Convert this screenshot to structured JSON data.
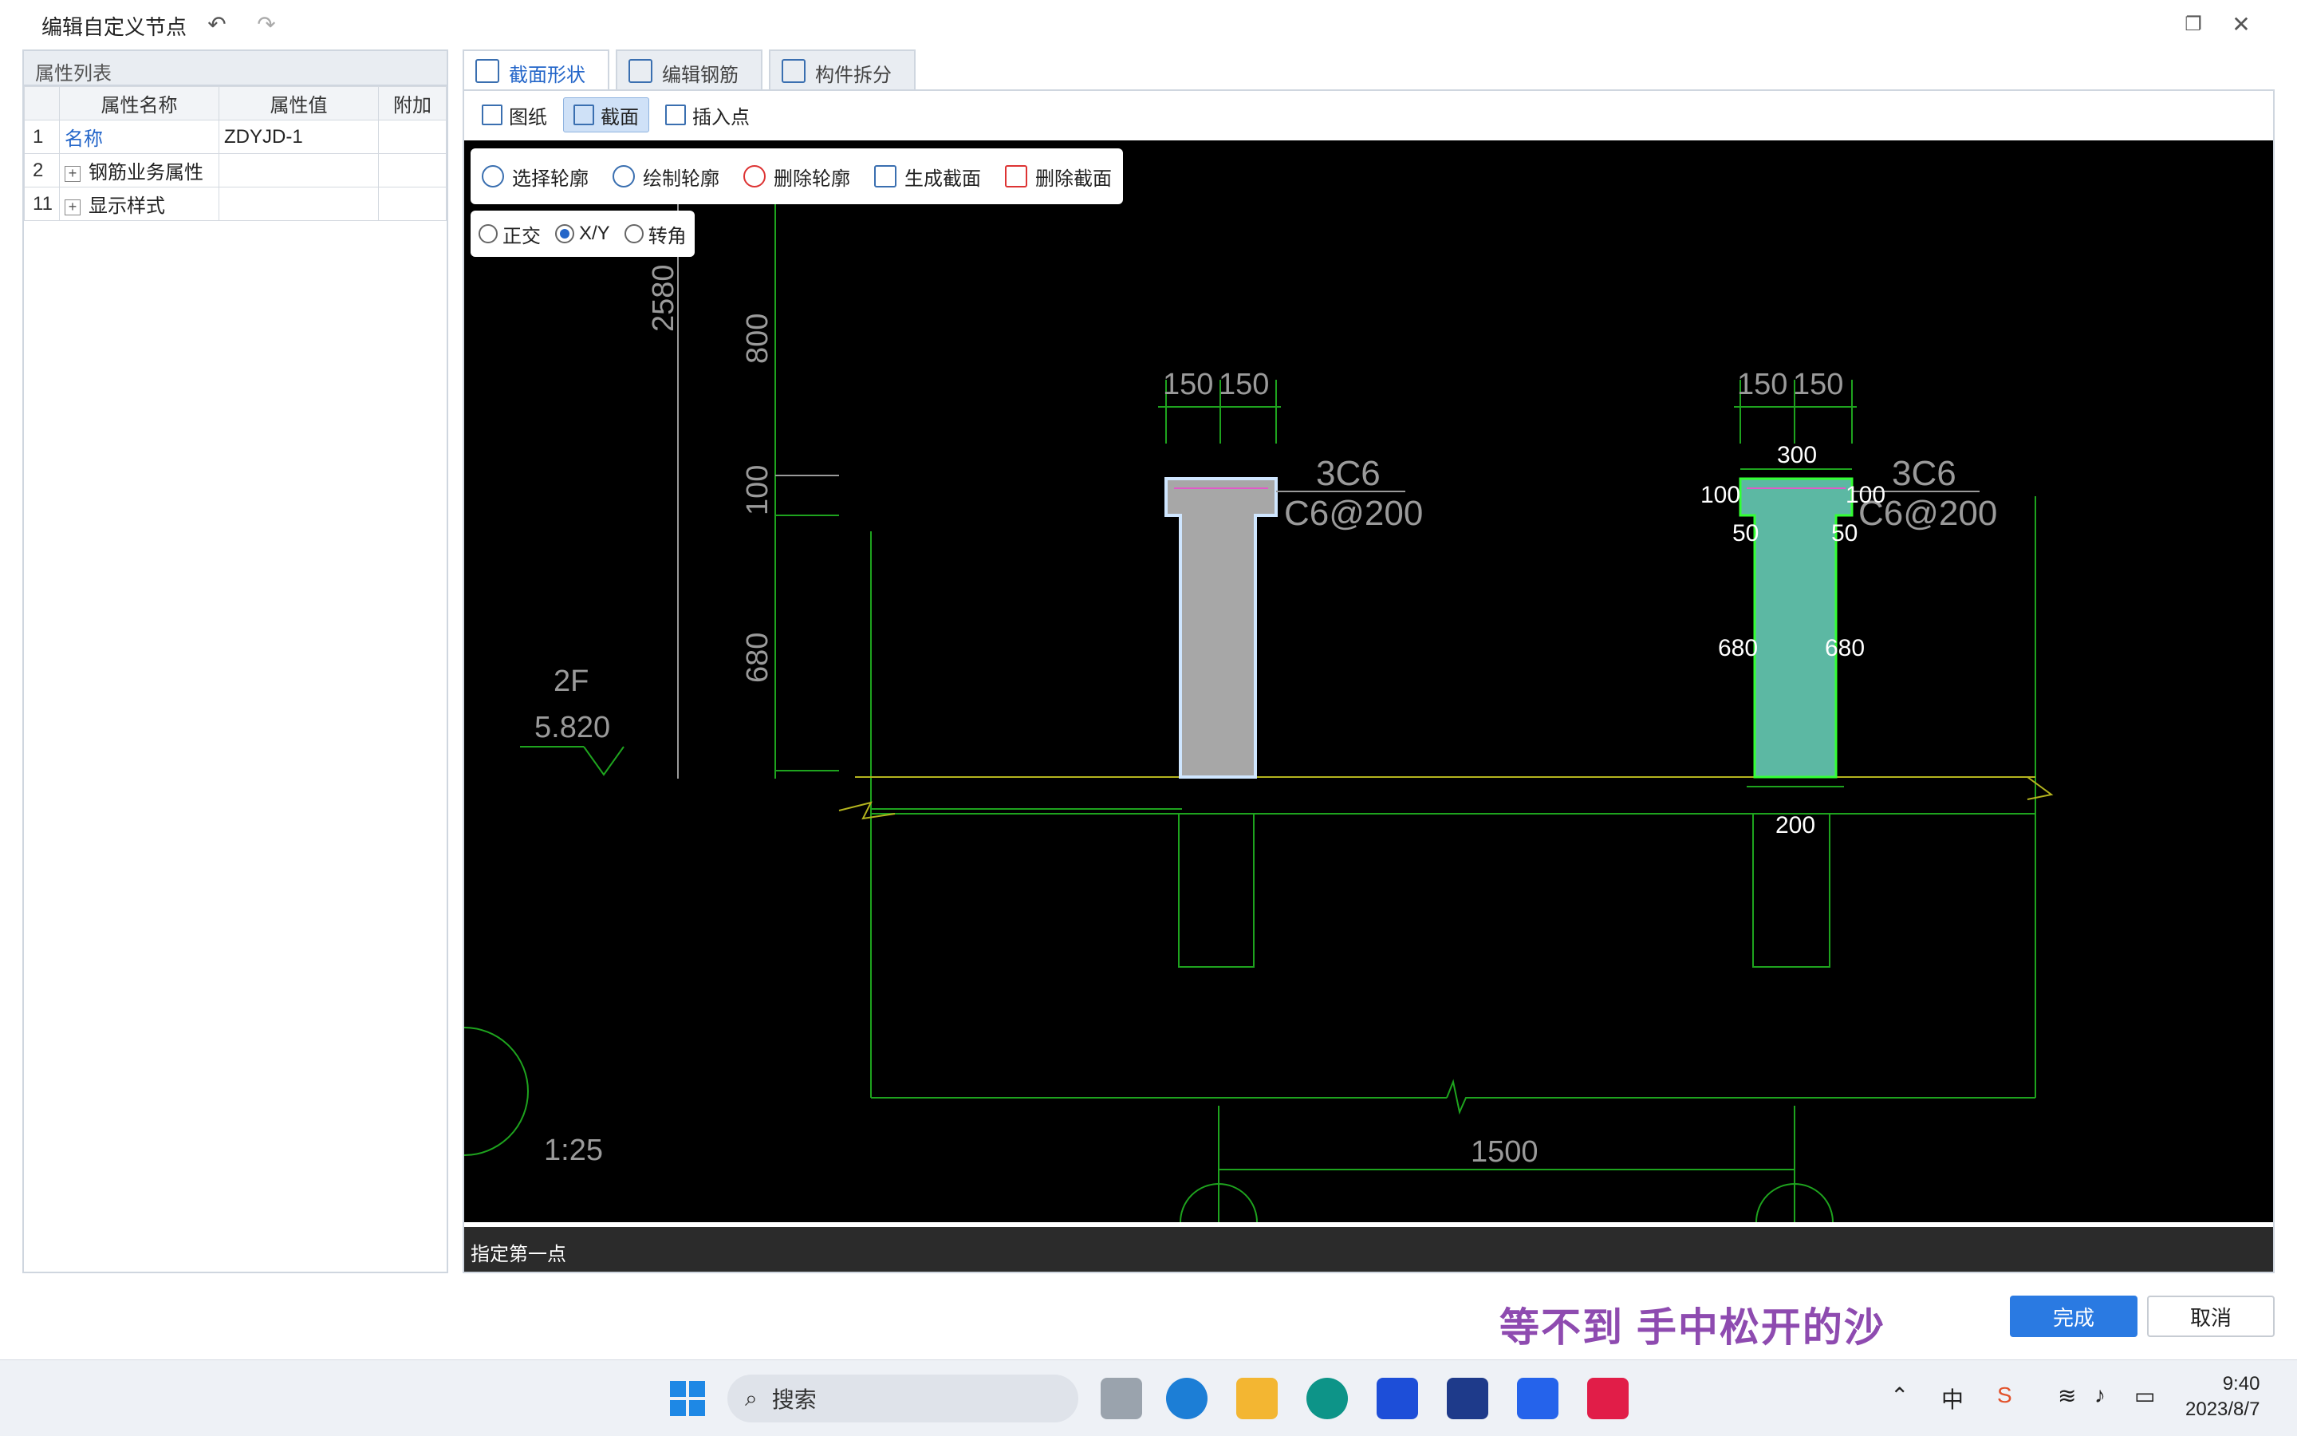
{
  "window": {
    "title": "编辑自定义节点",
    "undo_icon": "undo-icon",
    "redo_icon": "redo-icon",
    "restore_icon": "restore-icon",
    "close_icon": "close-icon"
  },
  "property_panel": {
    "header": "属性列表",
    "columns": [
      "属性名称",
      "属性值",
      "附加"
    ],
    "rows": [
      {
        "index": "1",
        "name": "名称",
        "value": "ZDYJD-1",
        "extra": "",
        "expandable": false
      },
      {
        "index": "2",
        "name": "钢筋业务属性",
        "value": "",
        "extra": "",
        "expandable": true
      },
      {
        "index": "11",
        "name": "显示样式",
        "value": "",
        "extra": "",
        "expandable": true
      }
    ]
  },
  "tabs": [
    {
      "label": "截面形状",
      "active": true
    },
    {
      "label": "编辑钢筋",
      "active": false
    },
    {
      "label": "构件拆分",
      "active": false
    }
  ],
  "subtoolbar": [
    {
      "label": "图纸",
      "active": false
    },
    {
      "label": "截面",
      "active": true
    },
    {
      "label": "插入点",
      "active": false
    }
  ],
  "canvas_tools": [
    {
      "label": "选择轮廓"
    },
    {
      "label": "绘制轮廓"
    },
    {
      "label": "删除轮廓"
    },
    {
      "label": "生成截面"
    },
    {
      "label": "删除截面"
    }
  ],
  "snap_modes": [
    {
      "label": "正交",
      "selected": false
    },
    {
      "label": "X/Y",
      "selected": true
    },
    {
      "label": "转角",
      "selected": false
    }
  ],
  "drawing": {
    "dims_left": [
      "2580",
      "800",
      "100",
      "680"
    ],
    "level_label": "2F",
    "level_value": "5.820",
    "scale": "1:25",
    "dims_top_a": [
      "150",
      "150"
    ],
    "dims_top_b": [
      "150",
      "150"
    ],
    "rebar_a": [
      "3C6",
      "C6@200"
    ],
    "rebar_b": [
      "3C6",
      "C6@200"
    ],
    "section_b_dims": {
      "top": "300",
      "left_flange": "100",
      "right_flange": "100",
      "left_step": "50",
      "right_step": "50",
      "left_height": "680",
      "right_height": "680",
      "bottom": "200"
    },
    "bottom_span": "1500",
    "colors": {
      "background": "#000000",
      "green": "#1ea31e",
      "olive": "#b4b41e",
      "grey_section": "#a7a7a7",
      "teal_section": "#5cb8a3",
      "dim_text": "#9a9a9a"
    }
  },
  "status": "指定第一点",
  "overlay_lyric": "等不到  手中松开的沙",
  "buttons": {
    "ok": "完成",
    "cancel": "取消"
  },
  "taskbar": {
    "search_placeholder": "搜索",
    "ime": "中",
    "time": "9:40",
    "date": "2023/8/7"
  }
}
